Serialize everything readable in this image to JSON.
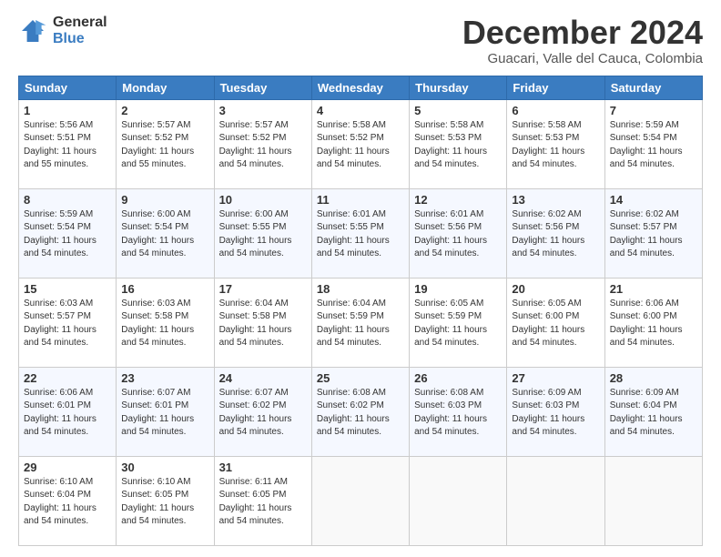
{
  "logo": {
    "general": "General",
    "blue": "Blue"
  },
  "title": "December 2024",
  "location": "Guacari, Valle del Cauca, Colombia",
  "headers": [
    "Sunday",
    "Monday",
    "Tuesday",
    "Wednesday",
    "Thursday",
    "Friday",
    "Saturday"
  ],
  "weeks": [
    [
      {
        "day": "1",
        "sunrise": "5:56 AM",
        "sunset": "5:51 PM",
        "daylight": "11 hours and 55 minutes."
      },
      {
        "day": "2",
        "sunrise": "5:57 AM",
        "sunset": "5:52 PM",
        "daylight": "11 hours and 55 minutes."
      },
      {
        "day": "3",
        "sunrise": "5:57 AM",
        "sunset": "5:52 PM",
        "daylight": "11 hours and 54 minutes."
      },
      {
        "day": "4",
        "sunrise": "5:58 AM",
        "sunset": "5:52 PM",
        "daylight": "11 hours and 54 minutes."
      },
      {
        "day": "5",
        "sunrise": "5:58 AM",
        "sunset": "5:53 PM",
        "daylight": "11 hours and 54 minutes."
      },
      {
        "day": "6",
        "sunrise": "5:58 AM",
        "sunset": "5:53 PM",
        "daylight": "11 hours and 54 minutes."
      },
      {
        "day": "7",
        "sunrise": "5:59 AM",
        "sunset": "5:54 PM",
        "daylight": "11 hours and 54 minutes."
      }
    ],
    [
      {
        "day": "8",
        "sunrise": "5:59 AM",
        "sunset": "5:54 PM",
        "daylight": "11 hours and 54 minutes."
      },
      {
        "day": "9",
        "sunrise": "6:00 AM",
        "sunset": "5:54 PM",
        "daylight": "11 hours and 54 minutes."
      },
      {
        "day": "10",
        "sunrise": "6:00 AM",
        "sunset": "5:55 PM",
        "daylight": "11 hours and 54 minutes."
      },
      {
        "day": "11",
        "sunrise": "6:01 AM",
        "sunset": "5:55 PM",
        "daylight": "11 hours and 54 minutes."
      },
      {
        "day": "12",
        "sunrise": "6:01 AM",
        "sunset": "5:56 PM",
        "daylight": "11 hours and 54 minutes."
      },
      {
        "day": "13",
        "sunrise": "6:02 AM",
        "sunset": "5:56 PM",
        "daylight": "11 hours and 54 minutes."
      },
      {
        "day": "14",
        "sunrise": "6:02 AM",
        "sunset": "5:57 PM",
        "daylight": "11 hours and 54 minutes."
      }
    ],
    [
      {
        "day": "15",
        "sunrise": "6:03 AM",
        "sunset": "5:57 PM",
        "daylight": "11 hours and 54 minutes."
      },
      {
        "day": "16",
        "sunrise": "6:03 AM",
        "sunset": "5:58 PM",
        "daylight": "11 hours and 54 minutes."
      },
      {
        "day": "17",
        "sunrise": "6:04 AM",
        "sunset": "5:58 PM",
        "daylight": "11 hours and 54 minutes."
      },
      {
        "day": "18",
        "sunrise": "6:04 AM",
        "sunset": "5:59 PM",
        "daylight": "11 hours and 54 minutes."
      },
      {
        "day": "19",
        "sunrise": "6:05 AM",
        "sunset": "5:59 PM",
        "daylight": "11 hours and 54 minutes."
      },
      {
        "day": "20",
        "sunrise": "6:05 AM",
        "sunset": "6:00 PM",
        "daylight": "11 hours and 54 minutes."
      },
      {
        "day": "21",
        "sunrise": "6:06 AM",
        "sunset": "6:00 PM",
        "daylight": "11 hours and 54 minutes."
      }
    ],
    [
      {
        "day": "22",
        "sunrise": "6:06 AM",
        "sunset": "6:01 PM",
        "daylight": "11 hours and 54 minutes."
      },
      {
        "day": "23",
        "sunrise": "6:07 AM",
        "sunset": "6:01 PM",
        "daylight": "11 hours and 54 minutes."
      },
      {
        "day": "24",
        "sunrise": "6:07 AM",
        "sunset": "6:02 PM",
        "daylight": "11 hours and 54 minutes."
      },
      {
        "day": "25",
        "sunrise": "6:08 AM",
        "sunset": "6:02 PM",
        "daylight": "11 hours and 54 minutes."
      },
      {
        "day": "26",
        "sunrise": "6:08 AM",
        "sunset": "6:03 PM",
        "daylight": "11 hours and 54 minutes."
      },
      {
        "day": "27",
        "sunrise": "6:09 AM",
        "sunset": "6:03 PM",
        "daylight": "11 hours and 54 minutes."
      },
      {
        "day": "28",
        "sunrise": "6:09 AM",
        "sunset": "6:04 PM",
        "daylight": "11 hours and 54 minutes."
      }
    ],
    [
      {
        "day": "29",
        "sunrise": "6:10 AM",
        "sunset": "6:04 PM",
        "daylight": "11 hours and 54 minutes."
      },
      {
        "day": "30",
        "sunrise": "6:10 AM",
        "sunset": "6:05 PM",
        "daylight": "11 hours and 54 minutes."
      },
      {
        "day": "31",
        "sunrise": "6:11 AM",
        "sunset": "6:05 PM",
        "daylight": "11 hours and 54 minutes."
      },
      null,
      null,
      null,
      null
    ]
  ]
}
